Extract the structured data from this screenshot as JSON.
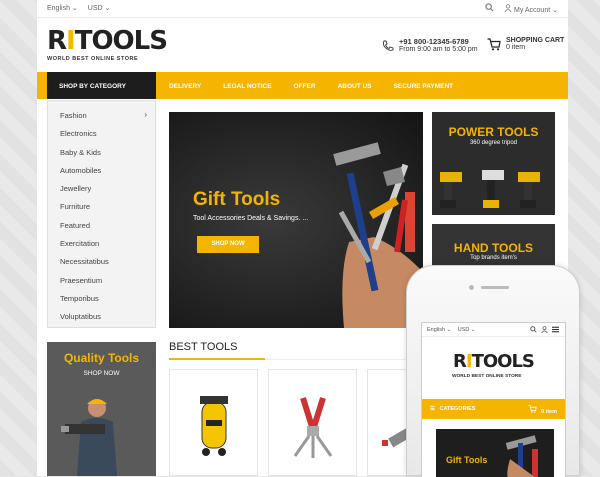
{
  "topbar": {
    "language": "English",
    "currency": "USD",
    "account": "My Account"
  },
  "logo": {
    "name_pre": "R",
    "name_i": "I",
    "name_post": "TOOLS",
    "tagline": "WORLD BEST ONLINE STORE"
  },
  "contact": {
    "phone": "+91 800-12345-6789",
    "hours": "From 9:00 am to 5:00 pm"
  },
  "cart": {
    "label": "SHOPPING CART",
    "count": "0 item"
  },
  "nav": {
    "category_label": "SHOP BY CATEGORY",
    "items": [
      "DELIVERY",
      "LEGAL NOTICE",
      "OFFER",
      "ABOUT US",
      "SECURE PAYMENT"
    ]
  },
  "sidebar": {
    "items": [
      "Fashion",
      "Electronics",
      "Baby & Kids",
      "Automobiles",
      "Jewellery",
      "Furniture",
      "Featured",
      "Exercitation",
      "Necessitatibus",
      "Praesentium",
      "Temporibus",
      "Voluptatibus"
    ]
  },
  "hero": {
    "title": "Gift Tools",
    "subtitle": "Tool Accessories Deals & Savings. ...",
    "button": "SHOP NOW"
  },
  "promo_power": {
    "title_a": "POWER",
    "title_b": "TOOLS",
    "subtitle": "360 degree tripod"
  },
  "promo_hand": {
    "title_a": "HAND",
    "title_b": "TOOLS",
    "subtitle": "Top brands item's"
  },
  "promo_quality": {
    "title": "Quality Tools",
    "subtitle": "SHOP NOW"
  },
  "best": {
    "title": "BEST TOOLS"
  },
  "mobile": {
    "language": "English",
    "currency": "USD",
    "categories": "CATEGORIES",
    "cart": "0 item",
    "hero_title": "Gift Tools"
  },
  "colors": {
    "accent": "#f5b400",
    "dark": "#1d1d1d"
  }
}
